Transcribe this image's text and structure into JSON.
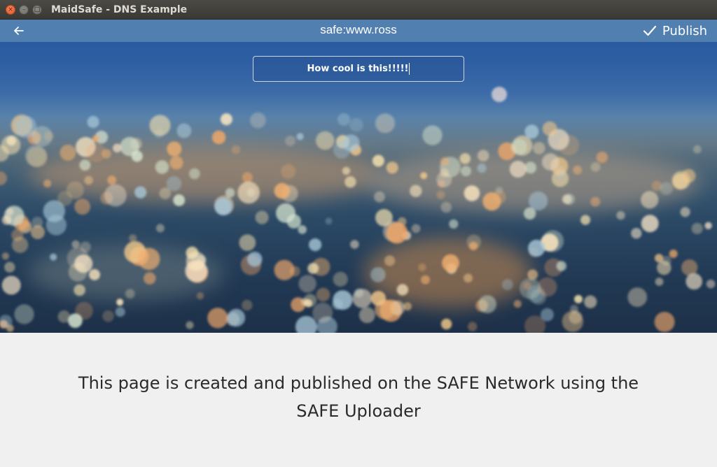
{
  "window": {
    "title": "MaidSafe - DNS Example",
    "controls": {
      "close": "×",
      "minimize": "–",
      "maximize": "□"
    }
  },
  "header": {
    "back_icon": "arrow-left-icon",
    "address": "safe:www.ross",
    "publish_icon": "check-icon",
    "publish_label": "Publish",
    "bar_color": "#5180b0"
  },
  "hero": {
    "title_input_value": "How cool is this!!!!!",
    "background": "blurred city lights bokeh"
  },
  "content": {
    "description": "This page is created and published on the SAFE Network using the SAFE Uploader"
  }
}
